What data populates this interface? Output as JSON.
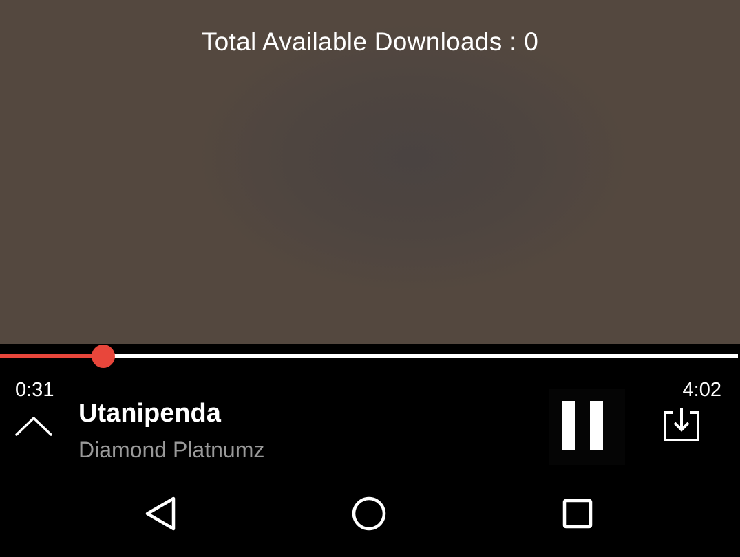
{
  "player": {
    "downloads_text": "Total Available Downloads : 0",
    "elapsed_time": "0:31",
    "total_time": "4:02",
    "progress_fraction": 0.128,
    "track_title": "Utanipenda",
    "track_artist": "Diamond Platnumz",
    "state": "playing"
  },
  "icons": {
    "expand": "chevron-up-icon",
    "pause": "pause-icon",
    "download": "download-icon",
    "back": "back-triangle-icon",
    "home": "home-circle-icon",
    "recents": "recents-square-icon"
  },
  "colors": {
    "accent": "#e8463b",
    "artist_text": "#9a9a9a",
    "background": "#000000",
    "artwork": "#4e4540"
  }
}
